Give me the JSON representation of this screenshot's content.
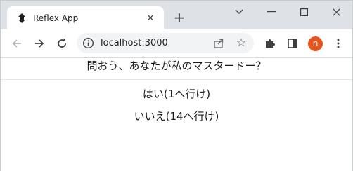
{
  "browser": {
    "tab_title": "Reflex App",
    "url": "localhost:3000",
    "profile_initial": "n",
    "accent_color": "#e8541e"
  },
  "page": {
    "question": "問おう、あなたが私のマスタードー？",
    "choices": [
      {
        "label": "はい(1へ行け)"
      },
      {
        "label": "いいえ(14へ行け)"
      }
    ]
  }
}
